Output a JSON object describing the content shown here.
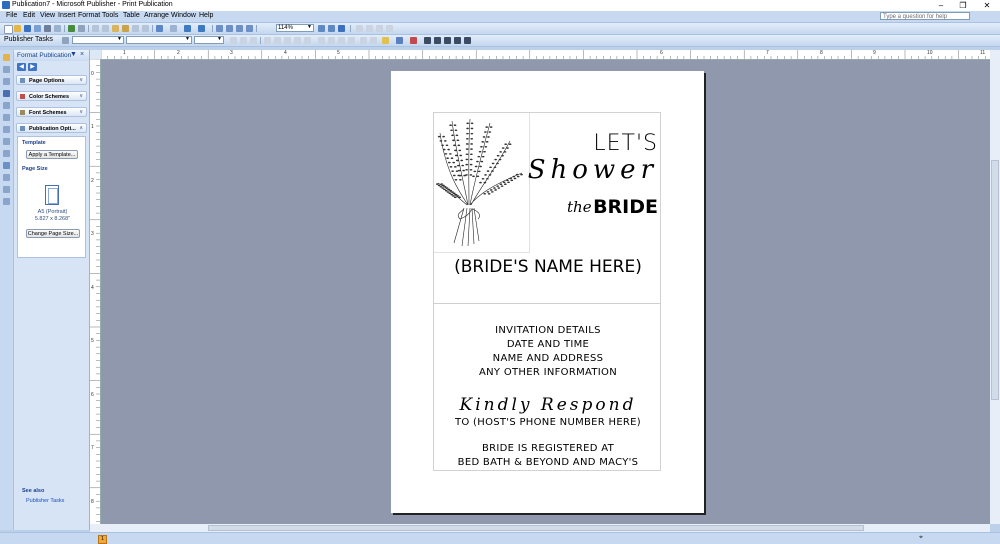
{
  "window": {
    "title": "Publication7 - Microsoft Publisher - Print Publication"
  },
  "menu": {
    "items": [
      "File",
      "Edit",
      "View",
      "Insert",
      "Format",
      "Tools",
      "Table",
      "Arrange",
      "Window",
      "Help"
    ],
    "ask_placeholder": "Type a question for help"
  },
  "formatting_toolbar": {
    "publisher_tasks": "Publisher Tasks",
    "zoom": "114%"
  },
  "task_pane": {
    "title": "Format Publication",
    "sections": [
      "Page Options",
      "Color Schemes",
      "Font Schemes",
      "Publication Opti..."
    ],
    "template_heading": "Template",
    "apply_template": "Apply a Template...",
    "page_size_heading": "Page Size",
    "page_size_name": "A5 (Portrait)",
    "page_size_dims": "5.827 x 8.268\"",
    "change_page_size": "Change Page Size...",
    "see_also": "See also",
    "see_also_link": "Publisher Tasks"
  },
  "ruler": {
    "h_numbers": [
      "1",
      "2",
      "3",
      "4",
      "5",
      "6",
      "7",
      "8",
      "9",
      "10",
      "11"
    ],
    "v_numbers": [
      "0",
      "1",
      "2",
      "3",
      "4",
      "5",
      "6",
      "7",
      "8"
    ]
  },
  "status": {
    "page": "1"
  },
  "invitation": {
    "lets": "LET'S",
    "shower": "Shower",
    "the": "the",
    "bride": "BRIDE",
    "bride_name": "(BRIDE'S NAME HERE)",
    "details": [
      "INVITATION DETAILS",
      "DATE AND TIME",
      "NAME AND ADDRESS",
      "ANY OTHER INFORMATION"
    ],
    "kindly_respond": "Kindly Respond",
    "host_phone": "TO (HOST'S PHONE NUMBER HERE)",
    "registry_line1": "BRIDE IS REGISTERED AT",
    "registry_line2": "BED BATH & BEYOND AND MACY'S"
  }
}
